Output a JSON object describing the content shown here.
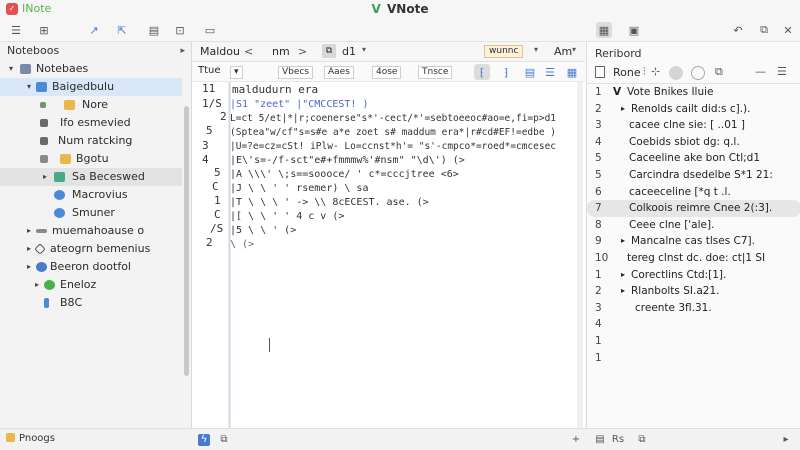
{
  "titlebar": {
    "app_name": "INote",
    "window_title": "VNote",
    "logo_letter": "V"
  },
  "toolbar": {
    "icons": [
      "menu-icon",
      "new-note-icon",
      "link-icon",
      "export-icon",
      "folder-icon",
      "preview-icon"
    ],
    "right_icons": [
      "layout-icon",
      "window-icon",
      "back-icon",
      "copy-icon",
      "close-icon"
    ]
  },
  "notebook": {
    "header": "Noteboos",
    "items": [
      {
        "label": "Notebaes",
        "arrow": "▾",
        "color": "#7a8aa8"
      },
      {
        "label": "Baigedbulu",
        "arrow": "▾",
        "color": "#4a8ad8"
      },
      {
        "label": "Nore",
        "arrow": "",
        "color": "#e8b84a"
      },
      {
        "label": "Ifo esmevied",
        "arrow": "",
        "color": "#6a6a6a"
      },
      {
        "label": "Num ratcking",
        "arrow": "",
        "color": "#6a6a6a"
      },
      {
        "label": "Bgotu",
        "arrow": "",
        "color": "#e8b84a"
      },
      {
        "label": "Sa Beceswed",
        "arrow": "▸",
        "color": "#4aa88a"
      },
      {
        "label": "Macrovius",
        "arrow": "",
        "color": "#4a8ad8"
      },
      {
        "label": "Smuner",
        "arrow": "",
        "color": "#4a8ad8"
      },
      {
        "label": "muemahoause o",
        "arrow": "▸",
        "color": "#8a8a8a"
      },
      {
        "label": "ateogrn bemenius",
        "arrow": "▸",
        "color": "#8a8a8a"
      },
      {
        "label": "Beeron dootfol",
        "arrow": "▸",
        "color": "#4a7ac8"
      },
      {
        "label": "Eneloz",
        "arrow": "",
        "color": "#4ab04a"
      },
      {
        "label": "B8C",
        "arrow": "",
        "color": "#4a8ad8"
      }
    ]
  },
  "editor": {
    "tabs": {
      "tab1": "Maldou",
      "tab2": "nm",
      "tab3": "d1",
      "tab4": "wunnc",
      "tab5": "Am"
    },
    "toolbar": {
      "chip1": "Ttue",
      "chip2": "Vbecs",
      "chip3": "Aaes",
      "chip4": "4ose",
      "chip5": "Tnsce"
    },
    "heading": "maldudurn era",
    "line_numbers": [
      "11",
      "1/S",
      "2",
      "5",
      "3",
      "4",
      "5",
      "C",
      "1",
      "C",
      "/S",
      "2"
    ],
    "lines": [
      "|S1 \"zeet\"    |\"CMCCEST!    )",
      "L=ct 5/et|*|r;coenerse\"s*'-cect/*'=sebtoeeoc#ao=e,fi=p>d1",
      "(Sptea\"w/cf\"s=s#e a*e  zoet s# maddum  era*|r#cd#EF!=edbe  )",
      "|U=?e=cz=cSt! iPlw-  Lo=ccnst*h'=  \"s'-cmpco*=roed*=cmcesec",
      "|E\\'s=-/f-sct\"e#+fmmmw%'#nsm\" \"\\d\\')    (>",
      "|A  \\\\\\' \\;s==soooce/  '  c*=cccjtree  <6>",
      "|J  \\ \\  '  ' rsemer)  \\  sa",
      "|T  \\ \\  \\  '  ->  \\\\ 8cECEST.  ase.  (>",
      "|[   \\  \\  '  '  4  c  v  (>",
      "|5   \\  \\  '  (>",
      "      \\   (>"
    ]
  },
  "outline": {
    "title": "Reribord",
    "search_value": "Rone",
    "rows": [
      {
        "num": "1",
        "arrow": "V",
        "text": "Vote Bnikes  Iluie"
      },
      {
        "num": "2",
        "arrow": "▸",
        "text": "Renolds cailt did:s c].)."
      },
      {
        "num": "3",
        "arrow": "",
        "text": "cacee clne sie:  [  ..01 ]"
      },
      {
        "num": "4",
        "arrow": "",
        "text": "Coebids sbiot dg: q.l."
      },
      {
        "num": "5",
        "arrow": "",
        "text": "Caceeline ake bon  Ctl;d1"
      },
      {
        "num": "5",
        "arrow": "",
        "text": "Carcindra dsedelbe  S*1 21:"
      },
      {
        "num": "6",
        "arrow": "",
        "text": "caceeceline [*q t .l."
      },
      {
        "num": "7",
        "arrow": "",
        "text": "Colkoois reimre  Cnee  2(:3]."
      },
      {
        "num": "8",
        "arrow": "",
        "text": "Ceee clne ['ale]."
      },
      {
        "num": "9",
        "arrow": "▸",
        "text": "Mancalne cas tlses  C7]."
      },
      {
        "num": "10",
        "arrow": "",
        "text": "tereg clnst dc. doe:  ct|1 SI"
      },
      {
        "num": "1",
        "arrow": "▸",
        "text": "Corectlins  Ctd:[1]."
      },
      {
        "num": "2",
        "arrow": "▸",
        "text": "Rlanbolts  SI.a21."
      },
      {
        "num": "3",
        "arrow": "",
        "text": "creente  3fl.31."
      },
      {
        "num": "4",
        "arrow": "",
        "text": ""
      },
      {
        "num": "1",
        "arrow": "",
        "text": ""
      },
      {
        "num": "1",
        "arrow": "",
        "text": ""
      }
    ]
  },
  "status": {
    "left_text": "Pnoogs",
    "right_icons": [
      "add-icon",
      "outline-icon",
      "text-icon",
      "more-icon"
    ],
    "abbr": "Rs"
  }
}
